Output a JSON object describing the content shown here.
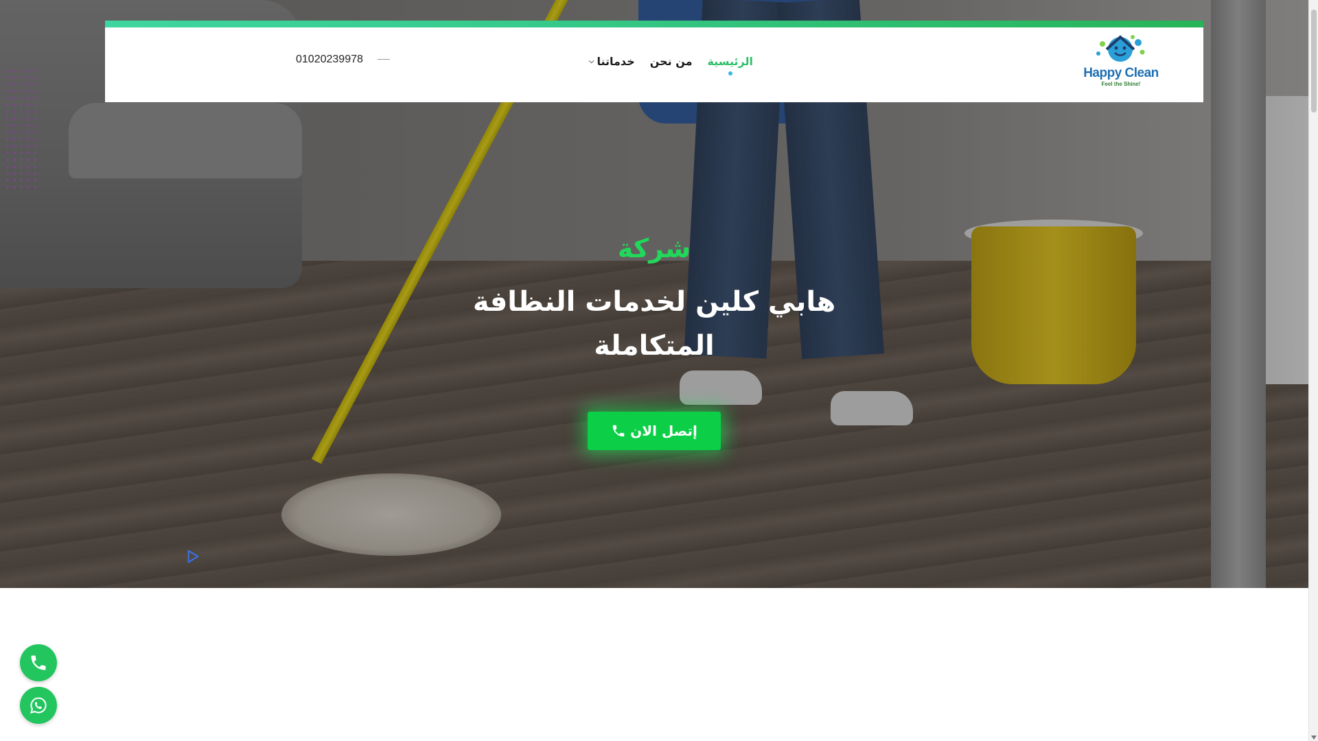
{
  "header": {
    "logo": {
      "brand": "Happy Clean",
      "tagline": "Feel the Shine!"
    },
    "nav": [
      {
        "label": "الرئيسية",
        "active": true
      },
      {
        "label": "من نحن",
        "active": false
      },
      {
        "label": "خدماتنا",
        "active": false,
        "has_dropdown": true
      }
    ],
    "phone": "01020239978"
  },
  "hero": {
    "kicker": "شركة",
    "title": "هابي كلين لخدمات النظافة المتكاملة",
    "cta_label": "إتصل الان"
  },
  "floating": {
    "call_icon": "phone-icon",
    "whatsapp_icon": "whatsapp-icon"
  },
  "colors": {
    "accent_green": "#0ccf47",
    "kicker_green": "#22d85a",
    "topbar_gradient": [
      "#3ed6a0",
      "#27b357"
    ],
    "active_dot": "#35b7e6"
  }
}
